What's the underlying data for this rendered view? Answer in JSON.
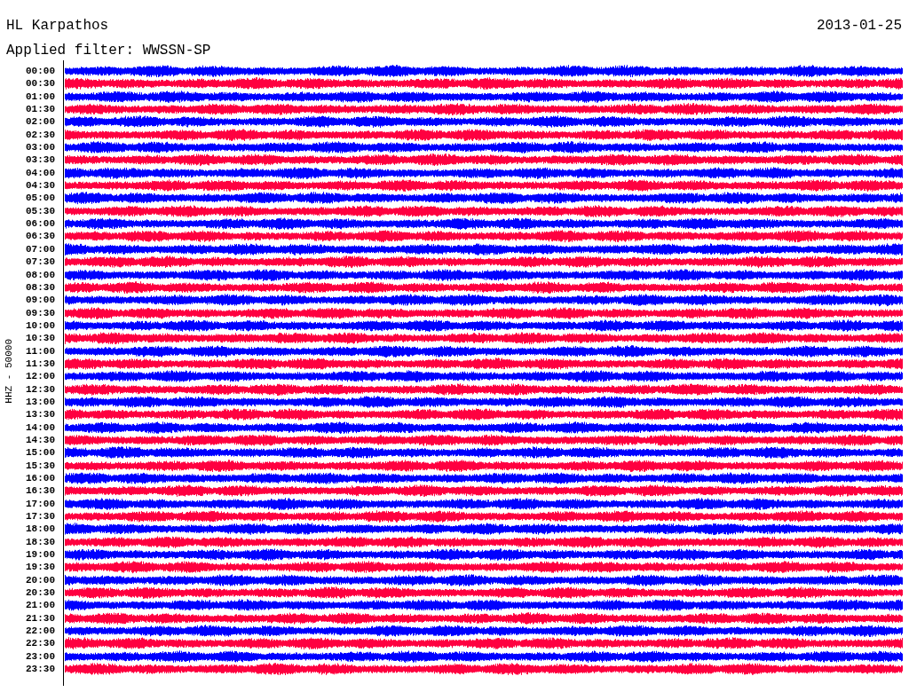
{
  "header": {
    "station": "HL Karpathos",
    "date": "2013-01-25",
    "filter": "Applied filter: WWSSN-SP"
  },
  "axis_label": "HHZ - 50000",
  "rows": [
    {
      "time": "00:00",
      "color": "#0000ff"
    },
    {
      "time": "00:30",
      "color": "#ff0040"
    },
    {
      "time": "01:00",
      "color": "#0000ff"
    },
    {
      "time": "01:30",
      "color": "#ff0040"
    },
    {
      "time": "02:00",
      "color": "#0000ff"
    },
    {
      "time": "02:30",
      "color": "#ff0040"
    },
    {
      "time": "03:00",
      "color": "#0000ff"
    },
    {
      "time": "03:30",
      "color": "#ff0040"
    },
    {
      "time": "04:00",
      "color": "#0000ff"
    },
    {
      "time": "04:30",
      "color": "#ff0040"
    },
    {
      "time": "05:00",
      "color": "#0000ff"
    },
    {
      "time": "05:30",
      "color": "#ff0040"
    },
    {
      "time": "06:00",
      "color": "#0000ff"
    },
    {
      "time": "06:30",
      "color": "#ff0040"
    },
    {
      "time": "07:00",
      "color": "#0000ff"
    },
    {
      "time": "07:30",
      "color": "#ff0040"
    },
    {
      "time": "08:00",
      "color": "#0000ff"
    },
    {
      "time": "08:30",
      "color": "#ff0040"
    },
    {
      "time": "09:00",
      "color": "#0000ff"
    },
    {
      "time": "09:30",
      "color": "#ff0040"
    },
    {
      "time": "10:00",
      "color": "#0000ff"
    },
    {
      "time": "10:30",
      "color": "#ff0040"
    },
    {
      "time": "11:00",
      "color": "#0000ff"
    },
    {
      "time": "11:30",
      "color": "#ff0040"
    },
    {
      "time": "12:00",
      "color": "#0000ff"
    },
    {
      "time": "12:30",
      "color": "#ff0040"
    },
    {
      "time": "13:00",
      "color": "#0000ff"
    },
    {
      "time": "13:30",
      "color": "#ff0040"
    },
    {
      "time": "14:00",
      "color": "#0000ff"
    },
    {
      "time": "14:30",
      "color": "#ff0040"
    },
    {
      "time": "15:00",
      "color": "#0000ff"
    },
    {
      "time": "15:30",
      "color": "#ff0040"
    },
    {
      "time": "16:00",
      "color": "#0000ff"
    },
    {
      "time": "16:30",
      "color": "#ff0040"
    },
    {
      "time": "17:00",
      "color": "#0000ff"
    },
    {
      "time": "17:30",
      "color": "#ff0040"
    },
    {
      "time": "18:00",
      "color": "#0000ff"
    },
    {
      "time": "18:30",
      "color": "#ff0040"
    },
    {
      "time": "19:00",
      "color": "#0000ff"
    },
    {
      "time": "19:30",
      "color": "#ff0040"
    },
    {
      "time": "20:00",
      "color": "#0000ff"
    },
    {
      "time": "20:30",
      "color": "#ff0040"
    },
    {
      "time": "21:00",
      "color": "#0000ff"
    },
    {
      "time": "21:30",
      "color": "#ff0040"
    },
    {
      "time": "22:00",
      "color": "#0000ff"
    },
    {
      "time": "22:30",
      "color": "#ff0040"
    },
    {
      "time": "23:00",
      "color": "#0000ff"
    },
    {
      "time": "23:30",
      "color": "#ff0040"
    }
  ]
}
